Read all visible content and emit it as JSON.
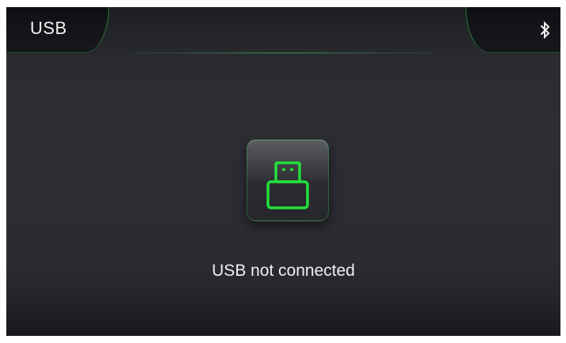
{
  "header": {
    "tab_left_label": "USB",
    "tab_right_icon": "bluetooth-icon"
  },
  "main": {
    "usb_icon": "usb-drive-icon",
    "status_text": "USB not connected"
  },
  "colors": {
    "accent_green": "#22e03a",
    "background": "#2a2c32",
    "tab_background": "#131417",
    "text": "#f0f0f0"
  }
}
